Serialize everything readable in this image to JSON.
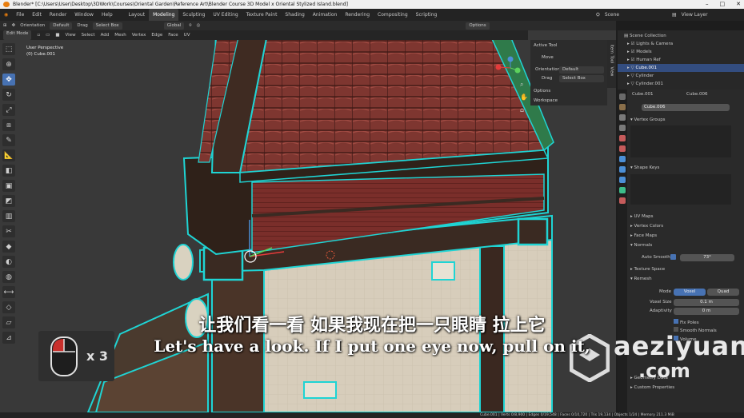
{
  "title_bar": "Blender* [C:\\Users\\User\\Desktop\\3DWork\\Courses\\Oriental Garden\\Reference Art\\Blender Course 3D Model x Oriental Stylized Island.blend]",
  "menu": [
    "File",
    "Edit",
    "Render",
    "Window",
    "Help"
  ],
  "workspaces": [
    "Layout",
    "Modeling",
    "Sculpting",
    "UV Editing",
    "Texture Paint",
    "Shading",
    "Animation",
    "Rendering",
    "Compositing",
    "Scripting"
  ],
  "active_workspace": "Modeling",
  "scene_label": "Scene",
  "view_layer_label": "View Layer",
  "header": {
    "orientation_label": "Orientation",
    "orientation_value": "Default",
    "drag_label": "Drag",
    "drag_value": "Select Box",
    "transform": "Global",
    "options": "Options"
  },
  "edit_header": {
    "mode": "Edit Mode",
    "items": [
      "View",
      "Select",
      "Add",
      "Mesh",
      "Vertex",
      "Edge",
      "Face",
      "UV"
    ]
  },
  "viewport": {
    "perspective": "User Perspective",
    "object": "(0) Cube.001"
  },
  "n_panel": {
    "active_tool": "Active Tool",
    "tool": "Move",
    "orientation_label": "Orientation",
    "orientation_value": "Default",
    "drag_label": "Drag",
    "drag_value": "Select Box",
    "options": "Options",
    "workspace": "Workspace",
    "tabs": [
      "Item",
      "Tool",
      "View"
    ]
  },
  "outliner": {
    "root": "Scene Collection",
    "items": [
      "Lights & Camera",
      "Models",
      "Human Ref",
      "Cube.001",
      "Cylinder",
      "Cylinder.001"
    ],
    "selected": "Cube.001"
  },
  "properties": {
    "object_left": "Cube.001",
    "object_right": "Cube.006",
    "mesh_data": "Cube.006",
    "sections": [
      "Vertex Groups",
      "Shape Keys",
      "UV Maps",
      "Vertex Colors",
      "Face Maps",
      "Normals",
      "Texture Space",
      "Remesh",
      "Geometry Data",
      "Custom Properties"
    ],
    "auto_smooth_label": "Auto Smooth",
    "auto_smooth_value": "73°",
    "mode_label": "Mode",
    "mode_voxel": "Voxel",
    "mode_quad": "Quad",
    "voxel_size_label": "Voxel Size",
    "voxel_size_value": "0.1 m",
    "adaptivity_label": "Adaptivity",
    "adaptivity_value": "0 m",
    "fix_poles": "Fix Poles",
    "smooth_normals": "Smooth Normals",
    "volume": "Volume"
  },
  "status_bar": "Cube.001 | Verts 0/8,900 | Edges 0/19,548 | Faces 0/10,720 | Tris 19,134 | Objects 1/24 | Memory 211.3 MiB",
  "subtitle_cn": "让我们看一看 如果我现在把一只眼睛 拉上它",
  "subtitle_en": "Let's have a look. If I put one eye now, pull on it,",
  "mouse_overlay": {
    "count": "x 3"
  },
  "watermark": {
    "line1": "aeziyuan",
    "line2": ".com"
  },
  "colors": {
    "accent": "#4772b3",
    "selection": "#26d9d9",
    "roof": "#8a3b34",
    "wood": "#3a2a22"
  }
}
